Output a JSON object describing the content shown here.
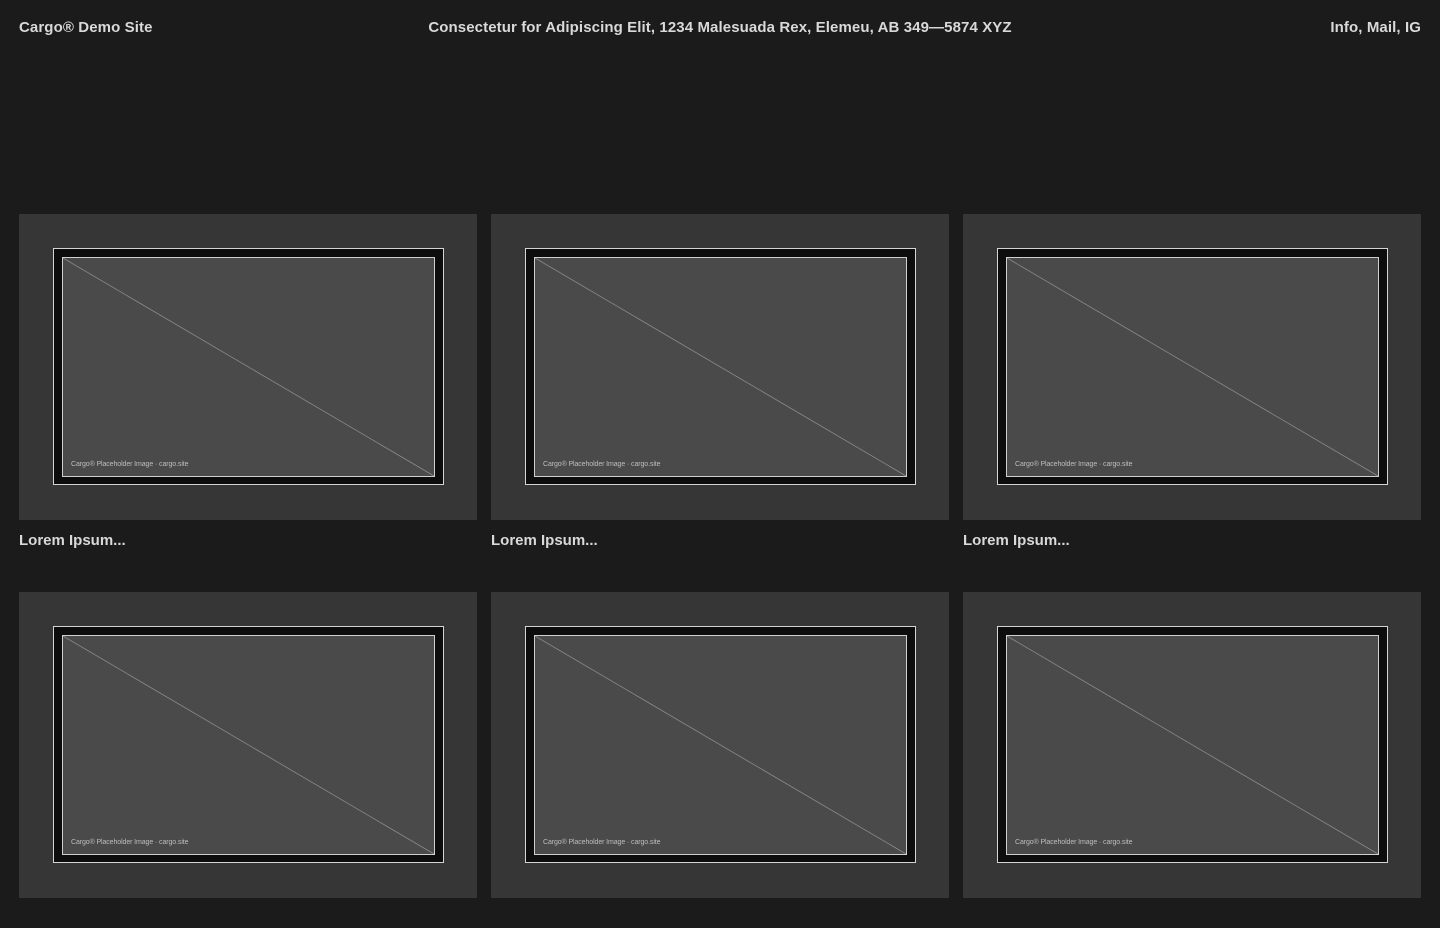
{
  "header": {
    "site_title": "Cargo® Demo Site",
    "address": "Consectetur for Adipiscing Elit, 1234 Malesuada Rex, Elemeu, AB 349—5874 XYZ",
    "links": {
      "info": "Info",
      "mail": "Mail",
      "ig": "IG",
      "separator": ", "
    }
  },
  "thumbnails": [
    {
      "title": "Lorem Ipsum...",
      "caption": "Cargo® Placeholder Image · cargo.site"
    },
    {
      "title": "Lorem Ipsum...",
      "caption": "Cargo® Placeholder Image · cargo.site"
    },
    {
      "title": "Lorem Ipsum...",
      "caption": "Cargo® Placeholder Image · cargo.site"
    },
    {
      "title": "",
      "caption": "Cargo® Placeholder Image · cargo.site"
    },
    {
      "title": "",
      "caption": "Cargo® Placeholder Image · cargo.site"
    },
    {
      "title": "",
      "caption": "Cargo® Placeholder Image · cargo.site"
    }
  ],
  "colors": {
    "background": "#1b1b1b",
    "text": "#d9d9d9",
    "thumb_background": "#363636",
    "image_fill": "#4a4a4a"
  },
  "icons": {
    "placeholder": "diagonal-line-placeholder-icon"
  }
}
